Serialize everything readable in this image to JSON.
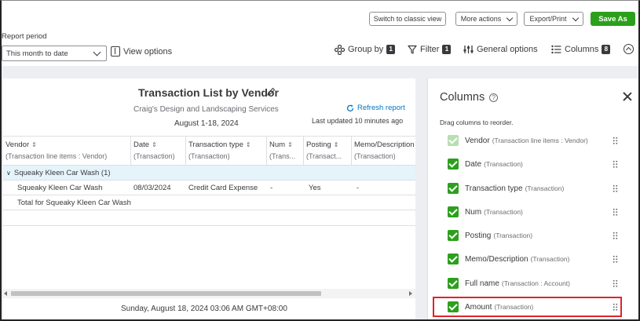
{
  "topbar": {
    "switch_label": "Switch to classic view",
    "more_actions_label": "More actions",
    "export_label": "Export/Print",
    "save_as_label": "Save As"
  },
  "filters": {
    "report_period_label": "Report period",
    "report_period_value": "This month to date",
    "view_options_label": "View options"
  },
  "toolbar": {
    "group_by_label": "Group by",
    "group_by_count": "1",
    "filter_label": "Filter",
    "filter_count": "1",
    "general_options_label": "General options",
    "columns_label": "Columns",
    "columns_count": "8"
  },
  "report": {
    "title": "Transaction List by Vendor",
    "company": "Craig's Design and Landscaping Services",
    "date_range": "August 1-18, 2024",
    "refresh_label": "Refresh report",
    "last_updated": "Last updated 10 minutes ago",
    "columns": [
      {
        "name": "Vendor",
        "sub": "(Transaction line items : Vendor)"
      },
      {
        "name": "Date",
        "sub": "(Transaction)"
      },
      {
        "name": "Transaction type",
        "sub": "(Transaction)"
      },
      {
        "name": "Num",
        "sub": "(Trans..."
      },
      {
        "name": "Posting",
        "sub": "(Transact..."
      },
      {
        "name": "Memo/Description",
        "sub": "(Transaction)"
      }
    ],
    "group_row": "Squeaky Kleen Car Wash (1)",
    "row": {
      "vendor": "Squeaky Kleen Car Wash",
      "date": "08/03/2024",
      "type": "Credit Card Expense",
      "num": "-",
      "posting": "Yes",
      "memo": "-"
    },
    "total_row": "Total for Squeaky Kleen Car Wash",
    "footer": "Sunday, August 18, 2024 03:06 AM GMT+08:00"
  },
  "panel": {
    "title": "Columns",
    "instruction": "Drag columns to reorder.",
    "items": [
      {
        "name": "Vendor",
        "sub": "(Transaction line items : Vendor)"
      },
      {
        "name": "Date",
        "sub": "(Transaction)"
      },
      {
        "name": "Transaction type",
        "sub": "(Transaction)"
      },
      {
        "name": "Num",
        "sub": "(Transaction)"
      },
      {
        "name": "Posting",
        "sub": "(Transaction)"
      },
      {
        "name": "Memo/Description",
        "sub": "(Transaction)"
      },
      {
        "name": "Full name",
        "sub": "(Transaction : Account)"
      },
      {
        "name": "Amount",
        "sub": "(Transaction)"
      }
    ]
  },
  "colors": {
    "accent_green": "#2ca01c",
    "link_blue": "#0077c5",
    "highlight_red": "#e0232a",
    "group_row_bg": "#e5f3fb"
  }
}
